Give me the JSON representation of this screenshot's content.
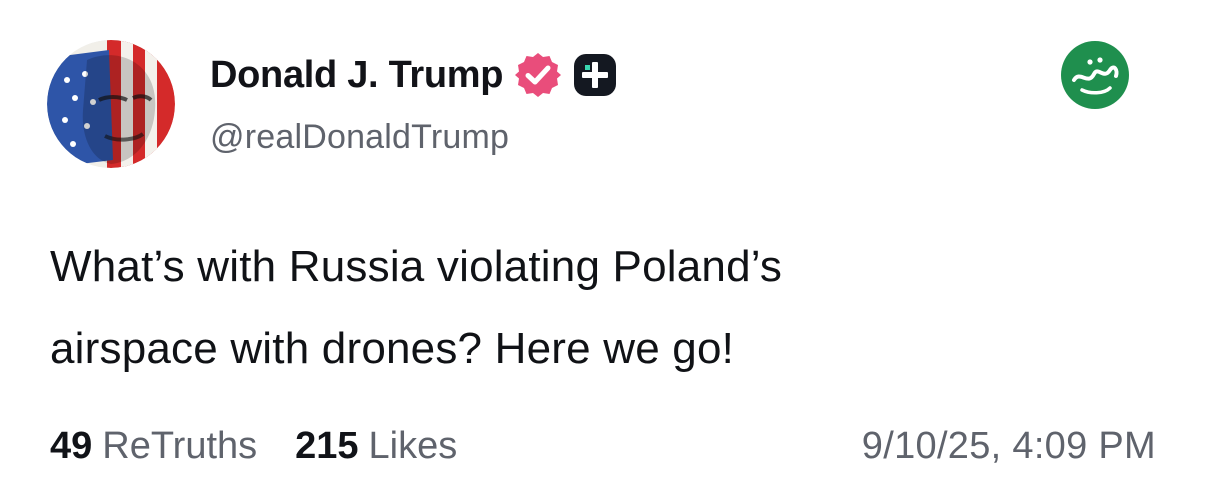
{
  "post": {
    "author": {
      "display_name": "Donald J. Trump",
      "handle": "@realDonaldTrump",
      "verified_badge_icon": "verified-check-icon",
      "verified_color": "#e94d7b",
      "plus_badge_icon": "plus-badge-icon"
    },
    "body_lines": [
      "What’s with Russia violating Poland’s",
      "airspace with drones? Here we go!"
    ],
    "stats": {
      "retruths_count": "49",
      "retruths_label": "ReTruths",
      "likes_count": "215",
      "likes_label": "Likes"
    },
    "timestamp": "9/10/25, 4:09 PM"
  },
  "watermark": {
    "icon": "channel-logo-icon",
    "color": "#1f8f4e"
  }
}
